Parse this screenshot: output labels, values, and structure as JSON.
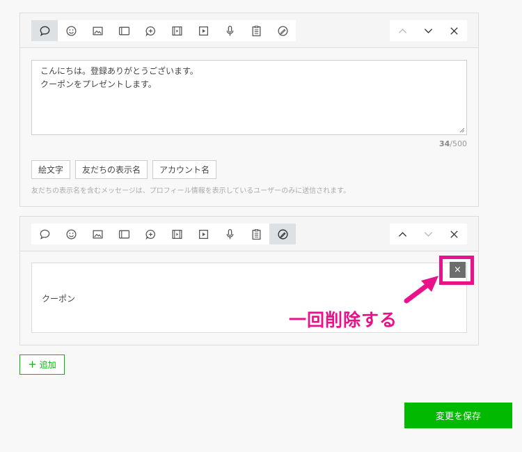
{
  "message1": {
    "text": "こんにちは。登録ありがとうございます。\nクーポンをプレゼントします。",
    "counter_current": "34",
    "counter_max": "/500",
    "chips": [
      "絵文字",
      "友だちの表示名",
      "アカウント名"
    ],
    "note": "友だちの表示名を含むメッセージは、プロフィール情報を表示しているユーザーのみに送信されます。",
    "active_type": "text"
  },
  "message2": {
    "coupon_label": "クーポン",
    "active_type": "coupon"
  },
  "annotation": {
    "text": "一回削除する",
    "color": "#e8138a"
  },
  "delete_label": "×",
  "add_button": {
    "icon": "+",
    "label": "追加"
  },
  "save_button": {
    "label": "変更を保存"
  },
  "toolbar_types": [
    "text-bubble-icon",
    "emoji-icon",
    "image-icon",
    "card-icon",
    "rich-message-icon",
    "video-frame-icon",
    "play-icon",
    "microphone-icon",
    "clipboard-icon",
    "coupon-icon"
  ],
  "colors": {
    "accent": "#00b900",
    "highlight": "#e8138a"
  }
}
